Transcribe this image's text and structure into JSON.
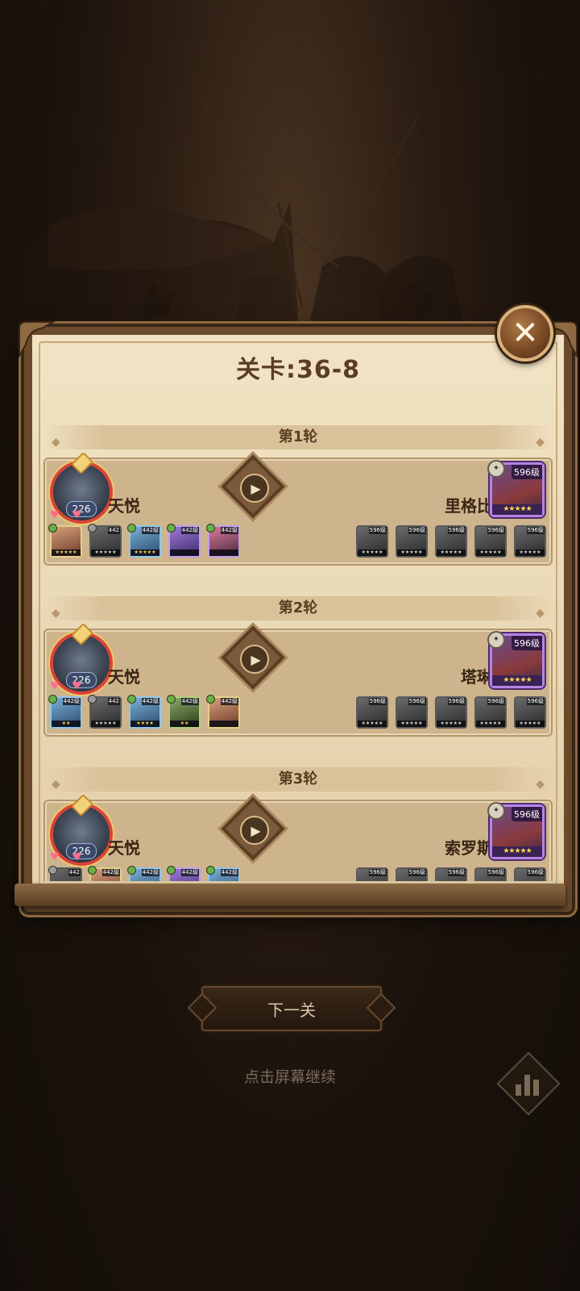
{
  "title": "关卡:36-8",
  "next_button": "下一关",
  "hint": "点击屏幕继续",
  "rounds": [
    {
      "label": "第1轮",
      "player_name": "天悦",
      "player_level": "226",
      "enemy_name": "里格比",
      "enemy_level": "596级",
      "enemy_stars": "★★★★★",
      "player_team": [
        {
          "level": "",
          "stars": "★★★★★",
          "style": "c1"
        },
        {
          "level": "442",
          "stars": "★★★★★",
          "style": "gray"
        },
        {
          "level": "442级",
          "stars": "★★★★★",
          "style": "c2"
        },
        {
          "level": "442级",
          "stars": "",
          "style": "c3"
        },
        {
          "level": "442级",
          "stars": "",
          "style": "c4"
        }
      ],
      "enemy_team": [
        {
          "level": "596级",
          "stars": "★★★★★",
          "style": "gray"
        },
        {
          "level": "596级",
          "stars": "★★★★★",
          "style": "gray"
        },
        {
          "level": "596级",
          "stars": "★★★★★",
          "style": "gray"
        },
        {
          "level": "596级",
          "stars": "★★★★★",
          "style": "gray"
        },
        {
          "level": "596级",
          "stars": "★★★★★",
          "style": "gray"
        }
      ]
    },
    {
      "label": "第2轮",
      "player_name": "天悦",
      "player_level": "226",
      "enemy_name": "塔琳",
      "enemy_level": "596级",
      "enemy_stars": "★★★★★",
      "player_team": [
        {
          "level": "442级",
          "stars": "★★",
          "style": "c2"
        },
        {
          "level": "442",
          "stars": "★★★★★",
          "style": "gray"
        },
        {
          "level": "442级",
          "stars": "★★★★",
          "style": "c2"
        },
        {
          "level": "442级",
          "stars": "★★",
          "style": "c5"
        },
        {
          "level": "442级",
          "stars": "",
          "style": "c1"
        }
      ],
      "enemy_team": [
        {
          "level": "596级",
          "stars": "★★★★★",
          "style": "gray"
        },
        {
          "level": "596级",
          "stars": "★★★★★",
          "style": "gray"
        },
        {
          "level": "596级",
          "stars": "★★★★★",
          "style": "gray"
        },
        {
          "level": "596级",
          "stars": "★★★★★",
          "style": "gray"
        },
        {
          "level": "596级",
          "stars": "★★★★★",
          "style": "gray"
        }
      ]
    },
    {
      "label": "第3轮",
      "player_name": "天悦",
      "player_level": "226",
      "enemy_name": "索罗斯",
      "enemy_level": "596级",
      "enemy_stars": "★★★★★",
      "player_team": [
        {
          "level": "442",
          "stars": "",
          "style": "gray"
        },
        {
          "level": "442级",
          "stars": "",
          "style": "c1"
        },
        {
          "level": "442级",
          "stars": "",
          "style": "c2"
        },
        {
          "level": "442级",
          "stars": "",
          "style": "c3"
        },
        {
          "level": "442级",
          "stars": "",
          "style": "c2"
        }
      ],
      "enemy_team": [
        {
          "level": "596级",
          "stars": "",
          "style": "gray"
        },
        {
          "level": "596级",
          "stars": "",
          "style": "gray"
        },
        {
          "level": "596级",
          "stars": "",
          "style": "gray"
        },
        {
          "level": "596级",
          "stars": "",
          "style": "gray"
        },
        {
          "level": "596级",
          "stars": "",
          "style": "gray"
        }
      ]
    }
  ]
}
